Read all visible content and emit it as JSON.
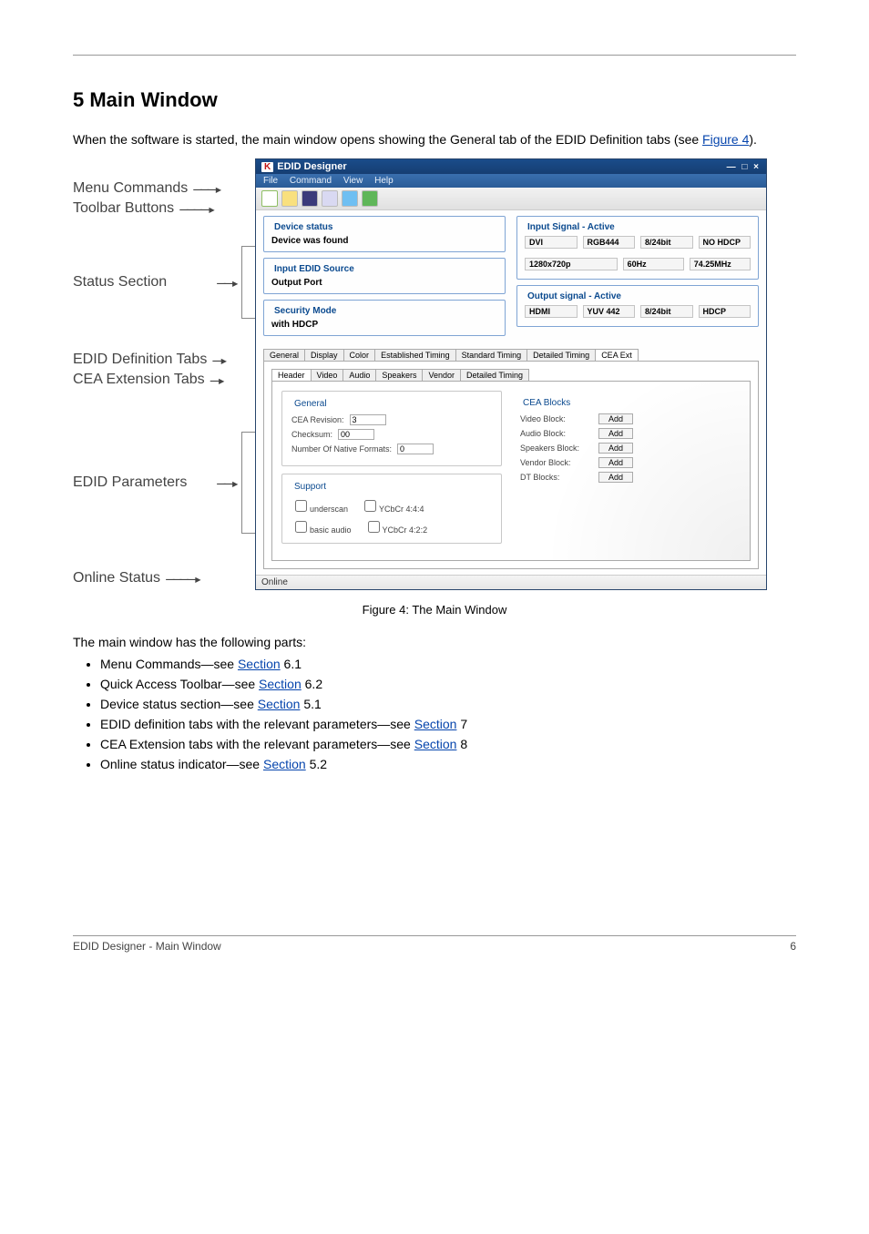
{
  "section_title": "5 Main Window",
  "intro_prefix": "When the software is started, the main window opens showing the General tab of the EDID Definition tabs (see ",
  "intro_link": "Figure 4",
  "intro_suffix": ").",
  "labels": {
    "menu": "Menu Commands",
    "toolbar": "Toolbar Buttons",
    "status": "Status Section",
    "edid_def_tabs": "EDID Definition Tabs",
    "cea_ext_tabs": "CEA Extension Tabs",
    "edid_params": "EDID Parameters",
    "online_status": "Online Status"
  },
  "app": {
    "title": "EDID Designer",
    "menu": {
      "file": "File",
      "command": "Command",
      "view": "View",
      "help": "Help"
    },
    "dev_status": {
      "title": "Device status",
      "msg": "Device was found"
    },
    "edid_src": {
      "title": "Input EDID Source",
      "msg": "Output Port"
    },
    "sec_mode": {
      "title": "Security Mode",
      "msg": "with HDCP"
    },
    "input_signal": {
      "title": "Input Signal - Active",
      "r1": {
        "a": "DVI",
        "b": "RGB444",
        "c": "8/24bit",
        "d": "NO HDCP"
      },
      "r2": {
        "a": "1280x720p",
        "b": "60Hz",
        "c": "74.25MHz"
      }
    },
    "output_signal": {
      "title": "Output signal - Active",
      "r1": {
        "a": "HDMI",
        "b": "YUV 442",
        "c": "8/24bit",
        "d": "HDCP"
      }
    },
    "def_tabs": {
      "general": "General",
      "display": "Display",
      "color": "Color",
      "est": "Established Timing",
      "std": "Standard Timing",
      "det": "Detailed Timing",
      "cea": "CEA Ext"
    },
    "cea_tabs": {
      "header": "Header",
      "video": "Video",
      "audio": "Audio",
      "speakers": "Speakers",
      "vendor": "Vendor",
      "dettiming": "Detailed Timing"
    },
    "general_group": {
      "title": "General",
      "cea_rev_label": "CEA Revision:",
      "cea_rev_val": "3",
      "chk_label": "Checksum:",
      "chk_val": "00",
      "native_label": "Number Of Native Formats:",
      "native_val": "0"
    },
    "support_group": {
      "title": "Support",
      "underscan": "underscan",
      "ycbcr444": "YCbCr 4:4:4",
      "basic_audio": "basic audio",
      "ycbcr422": "YCbCr 4:2:2"
    },
    "cea_blocks": {
      "title": "CEA Blocks",
      "video": "Video Block:",
      "audio": "Audio Block:",
      "speakers": "Speakers Block:",
      "vendor": "Vendor Block:",
      "dt": "DT Blocks:",
      "add": "Add"
    },
    "status_bar": "Online"
  },
  "figcaption": "Figure 4: The Main Window",
  "after": "The main window has the following parts:",
  "bullets": [
    {
      "text": "Menu Commands—see ",
      "link": "Section",
      "ref": " 6.1"
    },
    {
      "text": "Quick Access Toolbar—see ",
      "link": "Section",
      "ref": " 6.2"
    },
    {
      "text": "Device status section—see ",
      "link": "Section",
      "ref": " 5.1"
    },
    {
      "text": "EDID definition tabs with the relevant parameters—see ",
      "link": "Section",
      "ref": " 7"
    },
    {
      "text": "CEA Extension tabs with the relevant parameters—see ",
      "link": "Section",
      "ref": " 8"
    },
    {
      "text": "Online status indicator—see ",
      "link": "Section",
      "ref": " 5.2"
    }
  ],
  "footer": {
    "left": "EDID Designer - Main Window",
    "right": "6"
  }
}
